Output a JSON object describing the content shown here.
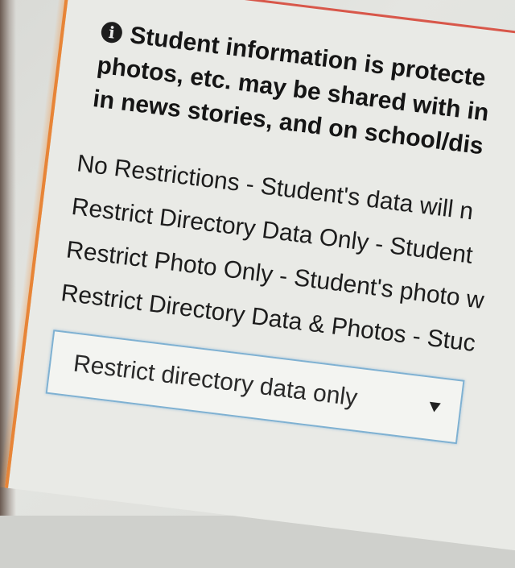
{
  "notice": {
    "icon": "info-icon",
    "line1": "Student information is protecte",
    "line2": "photos, etc. may be shared with in",
    "line3": "in news stories, and on school/dis"
  },
  "options": [
    {
      "label": "No Restrictions - Student's data will n"
    },
    {
      "label": "Restrict Directory Data Only - Student"
    },
    {
      "label": "Restrict Photo Only - Student's photo w"
    },
    {
      "label": "Restrict Directory Data & Photos - Stuc"
    }
  ],
  "select": {
    "value": "Restrict directory data only",
    "icon": "chevron-down-icon"
  },
  "colors": {
    "panel_border": "#e0762b",
    "select_border": "#7fb1d2"
  }
}
